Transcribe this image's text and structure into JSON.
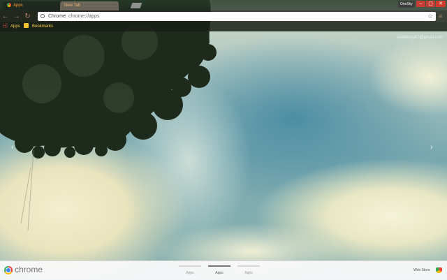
{
  "tabs": [
    {
      "title": "Apps",
      "active": true
    },
    {
      "title": "New Tab",
      "active": false
    }
  ],
  "window": {
    "profile": "OneSky",
    "minimize": "–",
    "maximize": "▢",
    "close": "✕"
  },
  "omnibox": {
    "chip": "Chrome",
    "separator": "|",
    "url": "chrome://apps"
  },
  "bookmarks": [
    {
      "label": "Apps",
      "icon": "apps-grid-icon"
    },
    {
      "label": "Bookmarks",
      "icon": "folder-icon"
    }
  ],
  "user": {
    "email": "evatkmay87@gmail.com"
  },
  "nav": {
    "left": "‹",
    "right": "›"
  },
  "bottom": {
    "brand": "chrome",
    "pages": [
      {
        "label": "Apps",
        "active": false
      },
      {
        "label": "Apps",
        "active": true
      },
      {
        "label": "Apps",
        "active": false
      }
    ],
    "webstore": "Web Store"
  },
  "colors": {
    "tab_text": "#ff9f3a",
    "bookmark_text": "#ffd34a",
    "close_button": "#d33b2c"
  }
}
